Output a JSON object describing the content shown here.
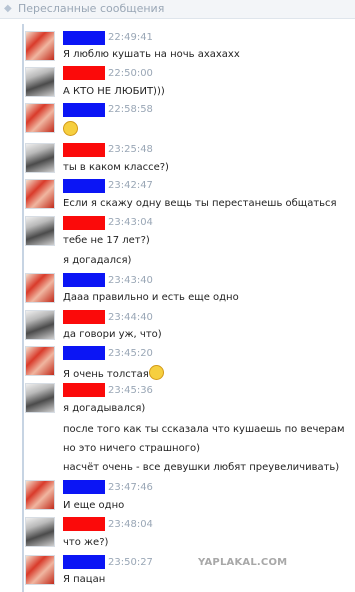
{
  "header": {
    "title": "Пересланные сообщения"
  },
  "messages": [
    {
      "time": "22:49:41",
      "lines": [
        "Я люблю кушать на ночь ахахахх"
      ]
    },
    {
      "time": "22:50:00",
      "lines": [
        "А КТО НЕ ЛЮБИТ)))"
      ]
    },
    {
      "time": "22:58:58",
      "lines": []
    },
    {
      "time": "23:25:48",
      "lines": [
        "ты в каком классе?)"
      ]
    },
    {
      "time": "23:42:47",
      "lines": [
        "Если я скажу одну вещь ты перестанешь общаться"
      ]
    },
    {
      "time": "23:43:04",
      "lines": [
        "тебе не 17 лет?)",
        "я догадался)"
      ]
    },
    {
      "time": "23:43:40",
      "lines": [
        "Дааа правильно и есть еще одно"
      ]
    },
    {
      "time": "23:44:40",
      "lines": [
        "да говори уж, что)"
      ]
    },
    {
      "time": "23:45:20",
      "lines": [
        "Я очень толстая"
      ]
    },
    {
      "time": "23:45:36",
      "lines": [
        "я догадывался)",
        "после того как ты ссказала что кушаешь по вечерам",
        "но это ничего страшного)",
        "насчёт очень - все девушки любят преувеличивать)"
      ]
    },
    {
      "time": "23:47:46",
      "lines": [
        "И еще одно"
      ]
    },
    {
      "time": "23:48:04",
      "lines": [
        "что же?)"
      ]
    },
    {
      "time": "23:50:27",
      "lines": [
        "Я пацан"
      ]
    }
  ],
  "watermark": "YAPLAKAL.COM",
  "colors": {
    "name_blue": "#0b15f5",
    "name_red": "#fb0a0a",
    "time": "#9aa7b6"
  }
}
